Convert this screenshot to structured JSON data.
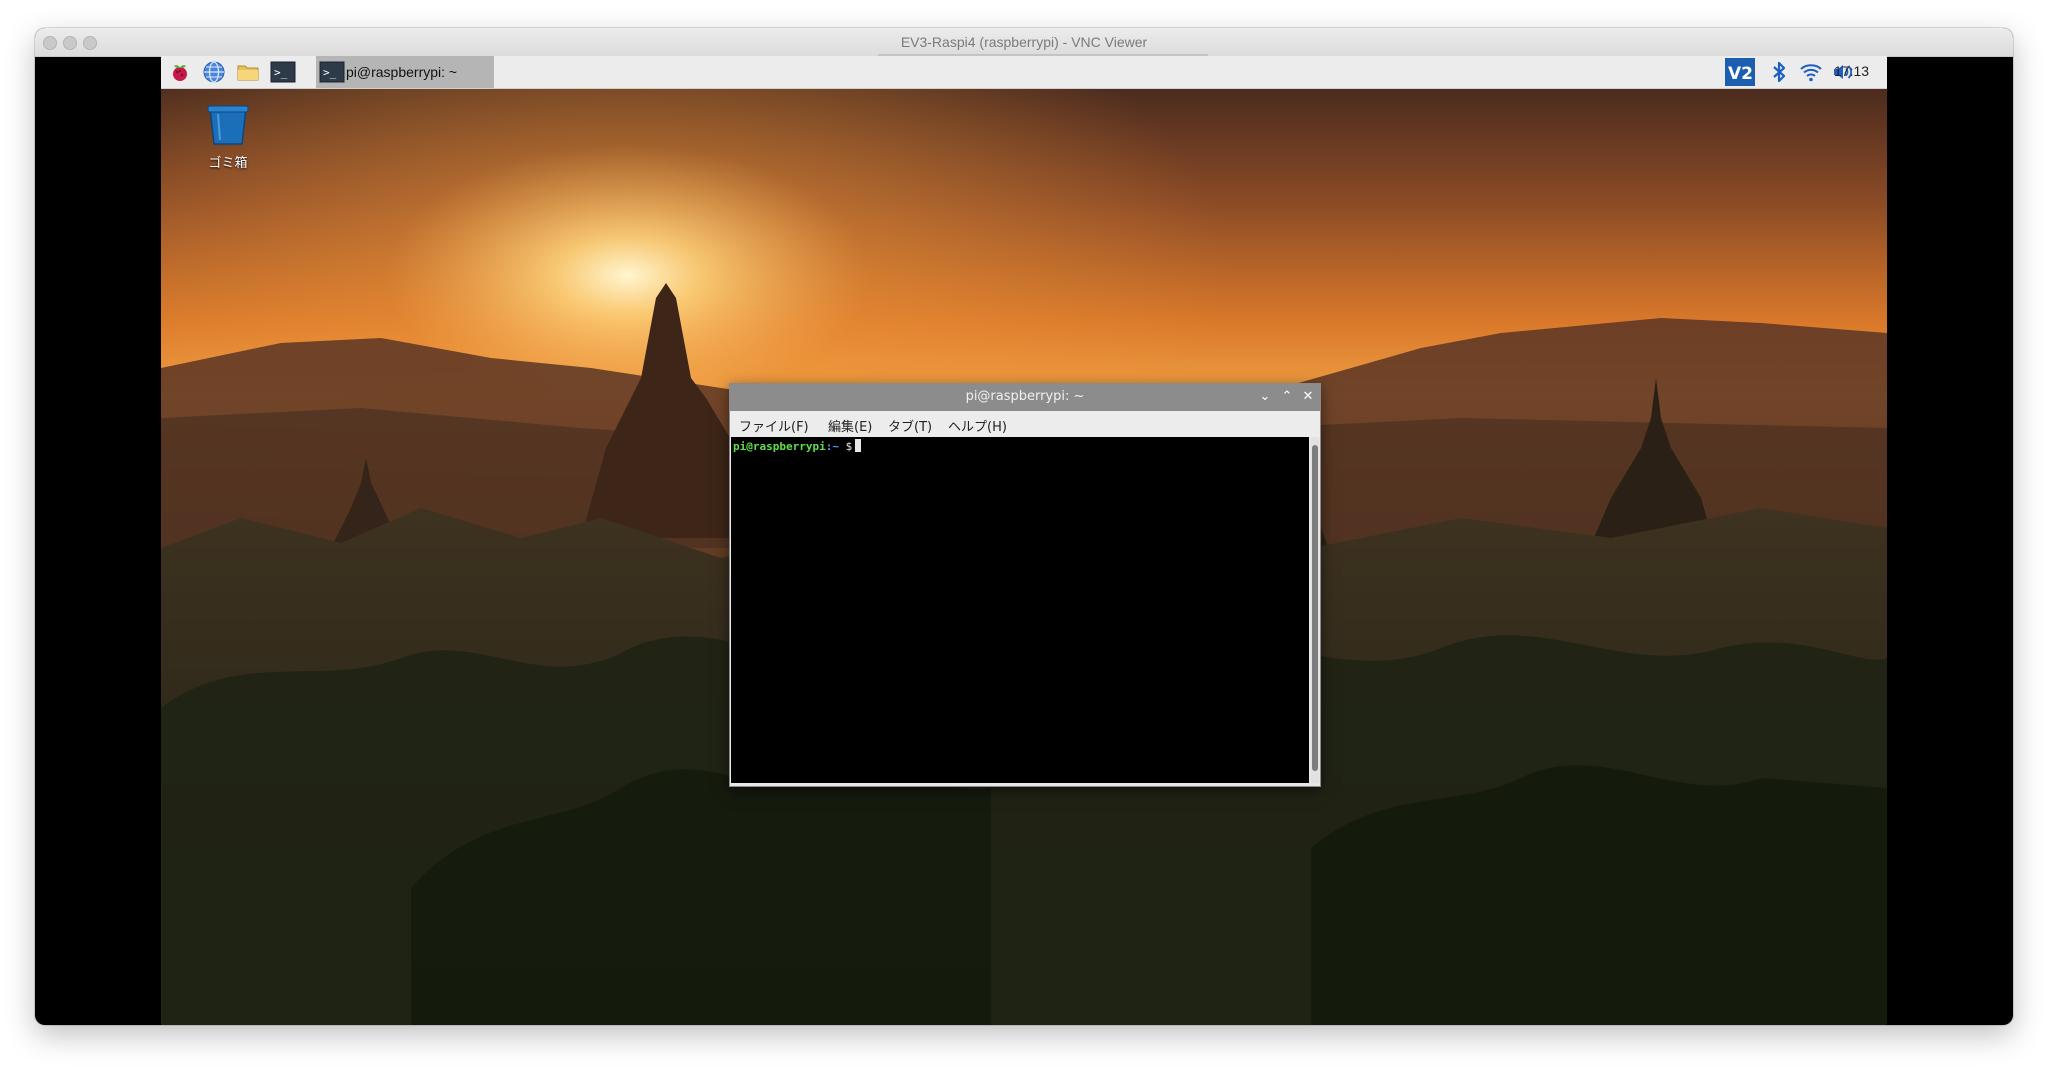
{
  "mac_window": {
    "title": "EV3-Raspi4 (raspberrypi) - VNC Viewer"
  },
  "taskbar": {
    "launchers": [
      {
        "icon": "raspberry-menu-icon"
      },
      {
        "icon": "web-browser-icon"
      },
      {
        "icon": "file-manager-icon"
      },
      {
        "icon": "terminal-icon"
      }
    ],
    "task": {
      "icon": "terminal-icon",
      "label": "pi@raspberrypi: ~"
    },
    "tray": {
      "vnc_icon": "vnc-server-icon",
      "bluetooth_icon": "bluetooth-icon",
      "wifi_icon": "wifi-icon",
      "volume_icon": "volume-icon",
      "clock": "17:13"
    }
  },
  "desktop": {
    "trash": {
      "icon": "trash-icon",
      "label": "ゴミ箱"
    }
  },
  "terminal": {
    "title": "pi@raspberrypi: ~",
    "menu": [
      "ファイル(F)",
      "編集(E)",
      "タブ(T)",
      "ヘルプ(H)"
    ],
    "prompt": {
      "user_host": "pi@raspberrypi",
      "path": ":~",
      "symbol": " $"
    },
    "colors": {
      "user": "#5fe04a",
      "path": "#6a8cff",
      "background": "#000000"
    }
  }
}
